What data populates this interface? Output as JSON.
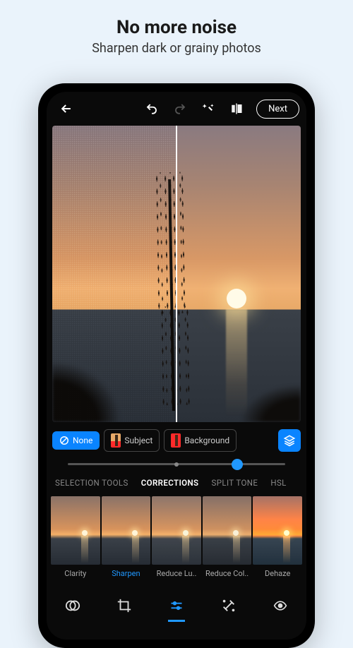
{
  "promo": {
    "title": "No more noise",
    "subtitle": "Sharpen dark or grainy photos"
  },
  "topbar": {
    "next_label": "Next"
  },
  "masks": {
    "none": "None",
    "subject": "Subject",
    "background": "Background"
  },
  "slider": {
    "value_pct": 78
  },
  "tabs": {
    "items": [
      "SELECTION TOOLS",
      "CORRECTIONS",
      "SPLIT TONE",
      "HSL"
    ],
    "active_index": 1
  },
  "presets": {
    "items": [
      {
        "label": "Clarity"
      },
      {
        "label": "Sharpen"
      },
      {
        "label": "Reduce Lu.."
      },
      {
        "label": "Reduce Col.."
      },
      {
        "label": "Dehaze"
      }
    ],
    "active_index": 1
  },
  "bottom_nav": {
    "items": [
      "looks",
      "crop",
      "adjust",
      "retouch",
      "redeye"
    ],
    "active_index": 2
  }
}
